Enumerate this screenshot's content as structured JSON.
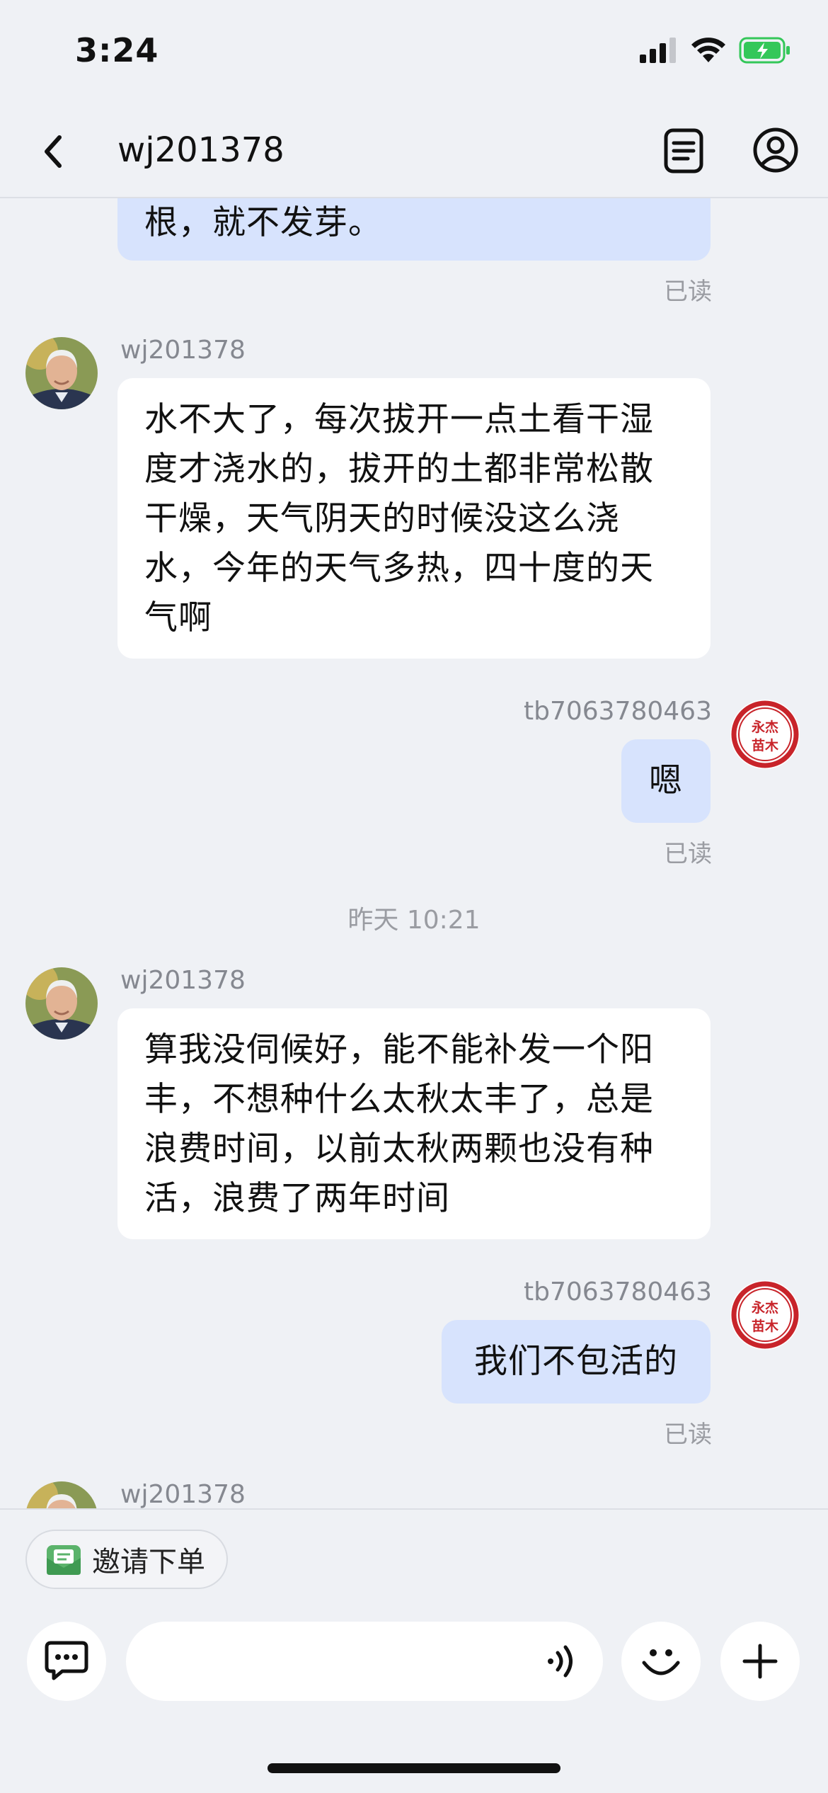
{
  "status_bar": {
    "time": "3:24"
  },
  "nav": {
    "title": "wj201378"
  },
  "messages": {
    "m1": {
      "text": "根，就不发芽。",
      "status": "已读"
    },
    "m2": {
      "sender": "wj201378",
      "text": "水不大了，每次拔开一点土看干湿度才浇水的，拔开的土都非常松散干燥，天气阴天的时候没这么浇水，今年的天气多热，四十度的天气啊"
    },
    "m3": {
      "sender": "tb7063780463",
      "text": "嗯",
      "status": "已读"
    },
    "divider": "昨天 10:21",
    "m4": {
      "sender": "wj201378",
      "text": "算我没伺候好，能不能补发一个阳丰，不想种什么太秋太丰了，总是浪费时间，以前太秋两颗也没有种活，浪费了两年时间"
    },
    "m5": {
      "sender": "tb7063780463",
      "text": "我们不包活的",
      "status": "已读"
    },
    "m6": {
      "sender": "wj201378"
    }
  },
  "seller_avatar": {
    "line1": "永杰",
    "line2": "苗木"
  },
  "bottom": {
    "invite_label": "邀请下单",
    "input_value": "",
    "input_placeholder": ""
  },
  "colors": {
    "background": "#eff1f5",
    "bubble_left": "#ffffff",
    "bubble_right": "#d7e3fd",
    "battery": "#34c759",
    "seal_red": "#c8242a"
  }
}
